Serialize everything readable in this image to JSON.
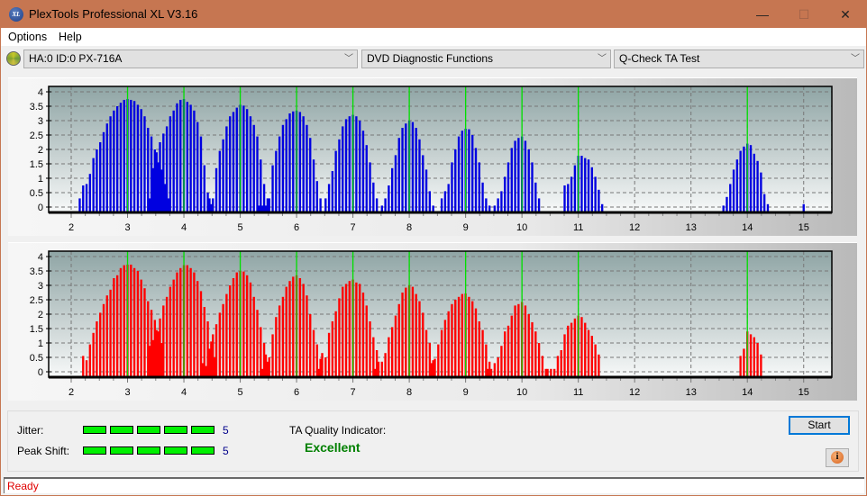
{
  "window": {
    "title": "PlexTools Professional XL V3.16",
    "app_icon_text": "XL",
    "minimize_glyph": "—",
    "maximize_glyph": "☐",
    "close_glyph": "✕"
  },
  "menu": [
    {
      "label": "Options"
    },
    {
      "label": "Help"
    }
  ],
  "toolbar": {
    "drive": "HA:0 ID:0  PX-716A",
    "function": "DVD Diagnostic Functions",
    "test": "Q-Check TA Test"
  },
  "results": {
    "jitter_label": "Jitter:",
    "jitter_value": "5",
    "jitter_level": 5,
    "peak_shift_label": "Peak Shift:",
    "peak_shift_value": "5",
    "peak_shift_level": 5,
    "max_level": 5,
    "ta_quality_label": "TA Quality Indicator:",
    "ta_quality_value": "Excellent"
  },
  "buttons": {
    "start": "Start",
    "info_glyph": "i"
  },
  "status": "Ready",
  "colors": {
    "titlebar": "#c67651",
    "top_bars": "#0000e0",
    "bottom_bars": "#ff0000",
    "peak_marker": "#00e000",
    "status_text": "#e00000",
    "quality_text": "#008000"
  },
  "chart_data": [
    {
      "type": "bar",
      "name": "top-histogram",
      "xlabel": "",
      "ylabel": "",
      "xlim": [
        1.6,
        15.5
      ],
      "ylim": [
        0,
        4
      ],
      "x_ticks": [
        "2",
        "3",
        "4",
        "5",
        "6",
        "7",
        "8",
        "9",
        "10",
        "11",
        "12",
        "13",
        "14",
        "15"
      ],
      "y_ticks": [
        "0",
        "0.5",
        "1",
        "1.5",
        "2",
        "2.5",
        "3",
        "3.5",
        "4"
      ],
      "grid": true,
      "peak_markers": [
        3,
        4,
        5,
        6,
        7,
        8,
        9,
        10,
        11,
        14
      ],
      "clusters": [
        {
          "center": 3,
          "peak": 3.75,
          "values": [
            0.3,
            0.75,
            0.8,
            1.15,
            1.7,
            2.0,
            2.25,
            2.6,
            2.9,
            3.15,
            3.35,
            3.5,
            3.62,
            3.72,
            3.75,
            3.72,
            3.68,
            3.55,
            3.4,
            3.15,
            2.75,
            2.45,
            2.0,
            1.55,
            1.3,
            0.8,
            0.3
          ]
        },
        {
          "center": 4,
          "peak": 3.75,
          "values": [
            0.3,
            1.35,
            1.9,
            2.25,
            2.55,
            2.8,
            3.15,
            3.35,
            3.6,
            3.72,
            3.75,
            3.65,
            3.55,
            3.35,
            2.95,
            2.45,
            1.45,
            0.5,
            0.1
          ]
        },
        {
          "center": 5,
          "peak": 3.55,
          "values": [
            0.3,
            0.3,
            1.35,
            1.95,
            2.35,
            2.8,
            3.15,
            3.3,
            3.45,
            3.55,
            3.52,
            3.4,
            3.15,
            2.85,
            2.45,
            1.65,
            0.8,
            0.3
          ]
        },
        {
          "center": 6,
          "peak": 3.35,
          "values": [
            0.05,
            0.05,
            0.05,
            0.3,
            1.45,
            1.95,
            2.45,
            2.85,
            3.05,
            3.25,
            3.32,
            3.35,
            3.3,
            3.15,
            2.85,
            2.4,
            1.65,
            0.9,
            0.3
          ]
        },
        {
          "center": 7,
          "peak": 3.2,
          "values": [
            0.3,
            0.8,
            1.25,
            1.95,
            2.35,
            2.8,
            3.05,
            3.15,
            3.2,
            3.15,
            3.0,
            2.65,
            2.15,
            1.55,
            0.85,
            0.3
          ]
        },
        {
          "center": 8,
          "peak": 3.0,
          "values": [
            0.05,
            0.3,
            0.75,
            1.35,
            1.8,
            2.4,
            2.75,
            2.9,
            3.0,
            2.95,
            2.75,
            2.35,
            1.8,
            1.3,
            0.55,
            0.05
          ]
        },
        {
          "center": 9,
          "peak": 2.72,
          "values": [
            0.3,
            0.55,
            0.8,
            1.55,
            2.0,
            2.45,
            2.65,
            2.72,
            2.7,
            2.5,
            2.05,
            1.55,
            0.85,
            0.3,
            0.05
          ]
        },
        {
          "center": 10,
          "peak": 2.45,
          "values": [
            0.05,
            0.3,
            0.55,
            1.05,
            1.55,
            2.05,
            2.3,
            2.4,
            2.45,
            2.3,
            2.0,
            1.55,
            0.85,
            0.3
          ]
        },
        {
          "center": 11,
          "peak": 1.78,
          "values": [
            0.75,
            0.8,
            1.05,
            1.45,
            1.78,
            1.78,
            1.7,
            1.65,
            1.38,
            1.05,
            0.6,
            0.1
          ]
        },
        {
          "center": 14,
          "peak": 2.2,
          "values": [
            0.05,
            0.35,
            0.8,
            1.3,
            1.65,
            1.95,
            2.1,
            2.2,
            2.15,
            1.85,
            1.6,
            1.2,
            0.45,
            0.1
          ]
        },
        {
          "center": 15,
          "peak": 0.1,
          "values": [
            0.1
          ]
        }
      ]
    },
    {
      "type": "bar",
      "name": "bottom-histogram",
      "xlabel": "",
      "ylabel": "",
      "xlim": [
        1.6,
        15.5
      ],
      "ylim": [
        0,
        4
      ],
      "x_ticks": [
        "2",
        "3",
        "4",
        "5",
        "6",
        "7",
        "8",
        "9",
        "10",
        "11",
        "12",
        "13",
        "14",
        "15"
      ],
      "y_ticks": [
        "0",
        "0.5",
        "1",
        "1.5",
        "2",
        "2.5",
        "3",
        "3.5",
        "4"
      ],
      "grid": true,
      "peak_markers": [
        3,
        4,
        5,
        6,
        7,
        8,
        9,
        10,
        11,
        14
      ],
      "clusters": [
        {
          "center": 3,
          "peak": 3.75,
          "values": [
            0.55,
            0.4,
            0.95,
            1.35,
            1.75,
            2.05,
            2.35,
            2.65,
            2.85,
            3.25,
            3.35,
            3.6,
            3.7,
            3.72,
            3.72,
            3.6,
            3.5,
            3.2,
            2.9,
            2.45,
            2.15,
            1.8,
            1.4,
            1.0
          ]
        },
        {
          "center": 4,
          "peak": 3.7,
          "values": [
            0.9,
            1.1,
            1.45,
            1.85,
            2.3,
            2.6,
            2.95,
            3.2,
            3.45,
            3.6,
            3.7,
            3.7,
            3.6,
            3.45,
            3.15,
            2.8,
            2.25,
            1.75,
            1.05,
            0.5
          ]
        },
        {
          "center": 5,
          "peak": 3.5,
          "values": [
            0.3,
            0.2,
            0.8,
            1.3,
            1.65,
            2.05,
            2.35,
            2.7,
            3.0,
            3.25,
            3.45,
            3.5,
            3.48,
            3.35,
            3.1,
            2.6,
            2.15,
            1.55,
            1.0,
            0.35
          ]
        },
        {
          "center": 6,
          "peak": 3.35,
          "values": [
            0.1,
            0.6,
            0.5,
            1.3,
            1.9,
            2.3,
            2.6,
            2.95,
            3.15,
            3.3,
            3.35,
            3.25,
            3.05,
            2.65,
            2.0,
            1.45,
            0.95,
            0.45
          ]
        },
        {
          "center": 7,
          "peak": 3.2,
          "values": [
            0.1,
            0.65,
            0.5,
            1.35,
            1.75,
            2.1,
            2.55,
            2.95,
            3.05,
            3.15,
            3.2,
            3.1,
            3.05,
            2.75,
            2.3,
            1.75,
            1.2,
            0.75
          ]
        },
        {
          "center": 8,
          "peak": 3.0,
          "values": [
            0.1,
            0.35,
            0.35,
            0.65,
            1.2,
            1.55,
            1.95,
            2.35,
            2.75,
            2.92,
            3.0,
            2.95,
            2.7,
            2.45,
            2.05,
            1.45,
            1.0,
            0.4
          ]
        },
        {
          "center": 9,
          "peak": 2.72,
          "values": [
            0.3,
            0.45,
            0.95,
            1.45,
            1.8,
            2.1,
            2.35,
            2.5,
            2.6,
            2.7,
            2.72,
            2.6,
            2.45,
            2.2,
            1.75,
            1.45,
            0.95,
            0.35
          ]
        },
        {
          "center": 10,
          "peak": 2.42,
          "values": [
            0.1,
            0.1,
            0.3,
            0.5,
            0.9,
            1.4,
            1.6,
            1.95,
            2.3,
            2.35,
            2.42,
            2.3,
            2.0,
            1.72,
            1.4,
            1.0,
            0.55,
            0.1
          ]
        },
        {
          "center": 11,
          "peak": 1.78,
          "values": [
            0.1,
            0.1,
            0.1,
            0.55,
            0.75,
            1.3,
            1.6,
            1.7,
            1.85,
            1.95,
            1.9,
            1.7,
            1.45,
            1.25,
            0.95,
            0.6
          ]
        },
        {
          "center": 14,
          "peak": 1.3,
          "values": [
            0.55,
            0.8,
            1.4,
            1.3,
            1.2,
            1.0,
            0.6
          ]
        }
      ]
    }
  ]
}
